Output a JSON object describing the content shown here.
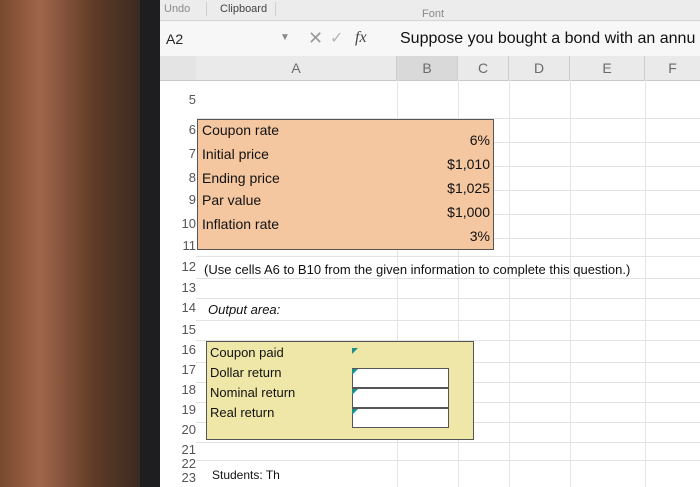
{
  "ribbon": {
    "undo": "Undo",
    "clipboard": "Clipboard",
    "font": "Font"
  },
  "formula_bar": {
    "cell_ref": "A2",
    "fx": "fx",
    "content": "Suppose you bought a bond with an annu"
  },
  "columns": [
    "A",
    "B",
    "C",
    "D",
    "E",
    "F"
  ],
  "rows": [
    "5",
    "6",
    "7",
    "8",
    "9",
    "10",
    "11",
    "12",
    "13",
    "14",
    "15",
    "16",
    "17",
    "18",
    "19",
    "20",
    "21",
    "22",
    "23"
  ],
  "inputs": [
    {
      "label": "Coupon rate",
      "value": "6%"
    },
    {
      "label": "Initial price",
      "value": "$1,010"
    },
    {
      "label": "Ending price",
      "value": "$1,025"
    },
    {
      "label": "Par value",
      "value": "$1,000"
    },
    {
      "label": "Inflation rate",
      "value": "3%"
    }
  ],
  "note": "(Use cells A6 to B10 from the given information to complete this question.)",
  "output_title": "Output area:",
  "outputs": [
    {
      "label": "Coupon paid",
      "value": ""
    },
    {
      "label": "Dollar return",
      "value": ""
    },
    {
      "label": "Nominal return",
      "value": ""
    },
    {
      "label": "Real return",
      "value": ""
    }
  ],
  "row23_text": "Students: Th",
  "colors": {
    "input_fill": "#f5c7a0",
    "output_fill": "#efe7a8",
    "flag": "#1a8f8f"
  }
}
